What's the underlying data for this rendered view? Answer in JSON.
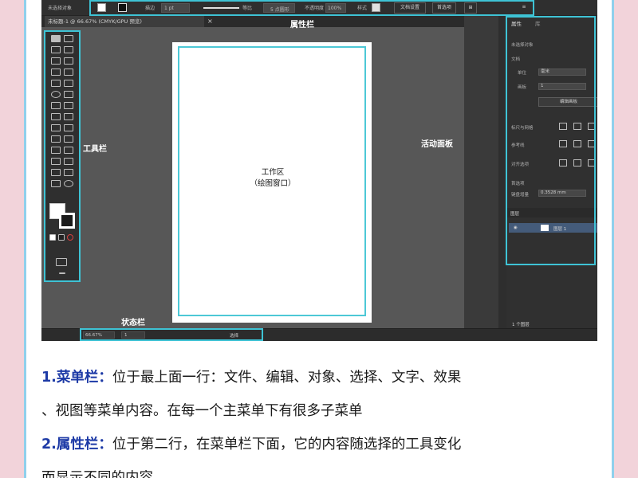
{
  "screenshot": {
    "property_bar": {
      "title": "未选择对象",
      "stroke_label": "描边",
      "stroke_value": "1 pt",
      "uniform_label": "等比",
      "brush_label": "5 点圆形",
      "opacity_label": "不透明度",
      "opacity_value": "100%",
      "style_label": "样式",
      "doc_setup_label": "文档设置",
      "prefs_label": "首选项"
    },
    "doc_tab": {
      "label": "未标题-1 @ 66.67% (CMYK/GPU 预览)",
      "close": "×"
    },
    "artboard": {
      "line1": "工作区",
      "line2": "（绘图窗口）"
    },
    "callouts": {
      "property_bar": "属性栏",
      "toolbar": "工具栏",
      "active_panel": "活动面板",
      "status_bar": "状态栏"
    },
    "panel": {
      "tab_properties": "属性",
      "tab_libraries": "库",
      "section_doc": "未选择对象",
      "section_doc2": "文档",
      "units_label": "单位",
      "units_value": "毫米",
      "artboard_label": "画板",
      "artboard_value": "1",
      "edit_artboard_button": "编辑画板",
      "ruler_grid_label": "标尺与网格",
      "guides_label": "参考线",
      "snap_label": "对齐选项",
      "prefs_label": "首选项",
      "keyboard_inc_label": "键盘增量",
      "keyboard_inc_value": "0.3528 mm",
      "layers_tab": "图层",
      "layer_name": "图层 1",
      "layers_footer": "1 个图层"
    },
    "status_bar": {
      "zoom": "66.67%",
      "artboard_num": "1",
      "tool_name": "选择"
    }
  },
  "text": {
    "item1_keyword": "1.菜单栏：",
    "item1_body": "位于最上面一行：文件、编辑、对象、选择、文字、效果",
    "item1_body2": "、视图等菜单内容。在每一个主菜单下有很多子菜单",
    "item2_keyword": "2.属性栏：",
    "item2_body": "位于第二行，在菜单栏下面，它的内容随选择的工具变化",
    "item2_body2": "而显示不同的内容。"
  },
  "colors": {
    "background": "#f2d3da",
    "highlight": "#3ec3d5",
    "keyword": "#1d3aa6"
  }
}
